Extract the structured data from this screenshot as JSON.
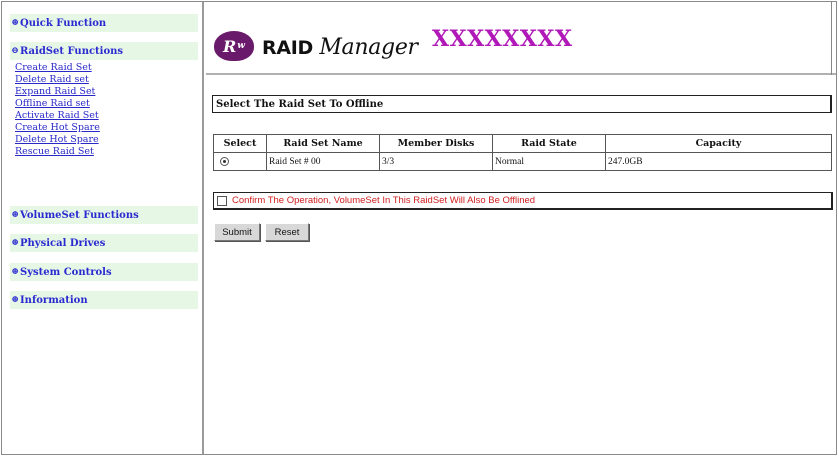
{
  "sidebar": {
    "quick_function": "Quick Function",
    "raidset_functions": "RaidSet Functions",
    "raidset_links": [
      "Create Raid Set",
      "Delete Raid set",
      "Expand Raid Set",
      "Offline Raid set",
      "Activate Raid Set",
      "Create Hot Spare",
      "Delete Hot Spare",
      "Rescue Raid Set"
    ],
    "volumeset_functions": "VolumeSet Functions",
    "physical_drives": "Physical Drives",
    "system_controls": "System Controls",
    "information": "Information"
  },
  "header": {
    "logo_badge": "R",
    "logo_word1": "RAID",
    "logo_word2": "Manager",
    "model": "XXXXXXXX"
  },
  "main": {
    "title": "Select The Raid Set To Offline",
    "table": {
      "headers": [
        "Select",
        "Raid Set Name",
        "Member Disks",
        "Raid State",
        "Capacity"
      ],
      "rows": [
        {
          "name": "Raid Set # 00",
          "disks": "3/3",
          "state": "Normal",
          "capacity": "247.0GB"
        }
      ]
    },
    "confirm_text": "Confirm The Operation, VolumeSet In This RaidSet Will Also Be Offlined",
    "submit_label": "Submit",
    "reset_label": "Reset"
  },
  "colors": {
    "link": "#2828c8",
    "section_bg": "#e6f7e6",
    "model_text": "#b018b8",
    "warning_text": "#d02020",
    "logo_badge": "#6a1a6a"
  }
}
